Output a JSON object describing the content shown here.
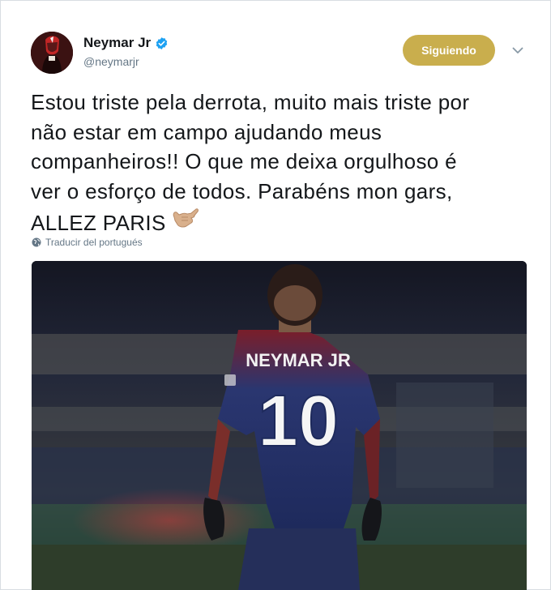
{
  "tweet": {
    "author": {
      "display_name": "Neymar Jr",
      "handle": "@neymarjr",
      "verified": true,
      "avatar_icon": "avatar-image"
    },
    "follow_button": {
      "label": "Siguiendo",
      "color": "#c9ae4d"
    },
    "more_menu_icon": "chevron-down-icon",
    "text_lines": [
      "Estou triste pela derrota, muito mais triste por",
      "não estar em campo ajudando meus",
      "companheiros!! O que me deixa orgulhoso é",
      "ver o esforço de todos. Parabéns mon gars,",
      "ALLEZ PARIS"
    ],
    "emoji": "call-me-hand-emoji",
    "translate_label": "Traducir del portugués",
    "translate_icon": "globe-icon",
    "media": {
      "jersey_name": "NEYMAR JR",
      "jersey_number": "10"
    }
  },
  "colors": {
    "text": "#14171a",
    "secondary": "#657786",
    "verified": "#1da1f2"
  }
}
